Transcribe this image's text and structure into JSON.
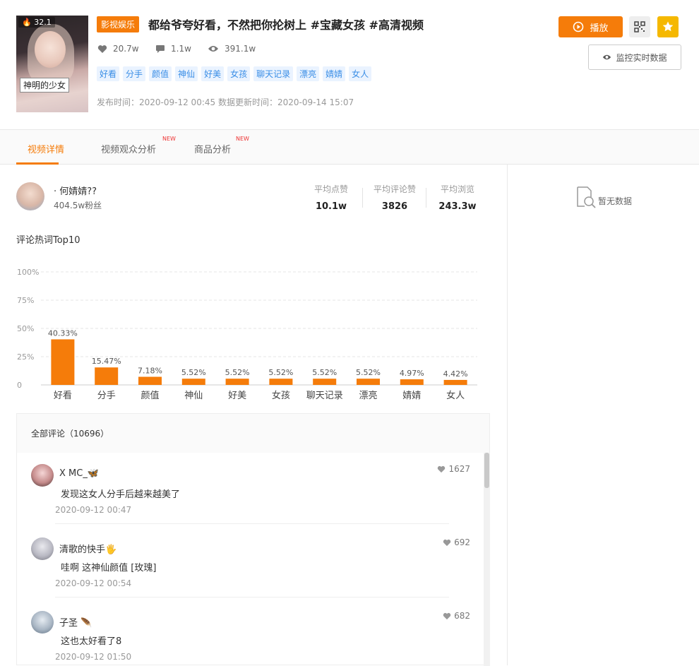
{
  "video": {
    "thumb_badge": "32.1",
    "thumb_caption": "神明的少女",
    "category": "影视娱乐",
    "title": "都给爷夸好看，不然把你抡树上 #宝藏女孩 #高清视频",
    "likes": "20.7w",
    "comments": "1.1w",
    "views": "391.1w",
    "tags": [
      "好看",
      "分手",
      "颜值",
      "神仙",
      "好美",
      "女孩",
      "聊天记录",
      "漂亮",
      "婧婧",
      "女人"
    ],
    "publish_time": "发布时间：2020-09-12 00:45 数据更新时间：2020-09-14 15:07"
  },
  "actions": {
    "play_label": "播放",
    "monitor_label": "监控实时数据"
  },
  "tabs": [
    {
      "label": "视频详情",
      "new": ""
    },
    {
      "label": "视频观众分析",
      "new": "NEW"
    },
    {
      "label": "商品分析",
      "new": "NEW"
    }
  ],
  "author": {
    "name": "· 何婧婧??",
    "fans": "404.5w粉丝",
    "metrics": [
      {
        "label": "平均点赞",
        "value": "10.1w"
      },
      {
        "label": "平均评论赞",
        "value": "3826"
      },
      {
        "label": "平均浏览",
        "value": "243.3w"
      }
    ]
  },
  "right_panel": {
    "empty_text": "暂无数据"
  },
  "chart_title": "评论热词Top10",
  "chart_data": {
    "type": "bar",
    "categories": [
      "好看",
      "分手",
      "颜值",
      "神仙",
      "好美",
      "女孩",
      "聊天记录",
      "漂亮",
      "婧婧",
      "女人"
    ],
    "values": [
      40.33,
      15.47,
      7.18,
      5.52,
      5.52,
      5.52,
      5.52,
      5.52,
      4.97,
      4.42
    ],
    "value_labels": [
      "40.33%",
      "15.47%",
      "7.18%",
      "5.52%",
      "5.52%",
      "5.52%",
      "5.52%",
      "5.52%",
      "4.97%",
      "4.42%"
    ],
    "y_ticks": [
      "100%",
      "75%",
      "50%",
      "25%",
      "0"
    ],
    "ylim": [
      0,
      100
    ],
    "grid": true,
    "color": "#f57c0a"
  },
  "comments": {
    "header": "全部评论（10696）",
    "items": [
      {
        "user": "X MC_🦋",
        "text": "发现这女人分手后越来越美了",
        "time": "2020-09-12 00:47",
        "likes": "1627"
      },
      {
        "user": "清歌的快手🖐",
        "text": "哇啊 这神仙颜值 [玫瑰]",
        "time": "2020-09-12 00:54",
        "likes": "692"
      },
      {
        "user": "子圣 🪶",
        "text": "这也太好看了8",
        "time": "2020-09-12 01:50",
        "likes": "682"
      }
    ]
  },
  "colors": {
    "accent": "#f57c0a",
    "tag_bg": "#eaf3ff",
    "tag_text": "#3a8ee6",
    "gold": "#f5b800"
  }
}
